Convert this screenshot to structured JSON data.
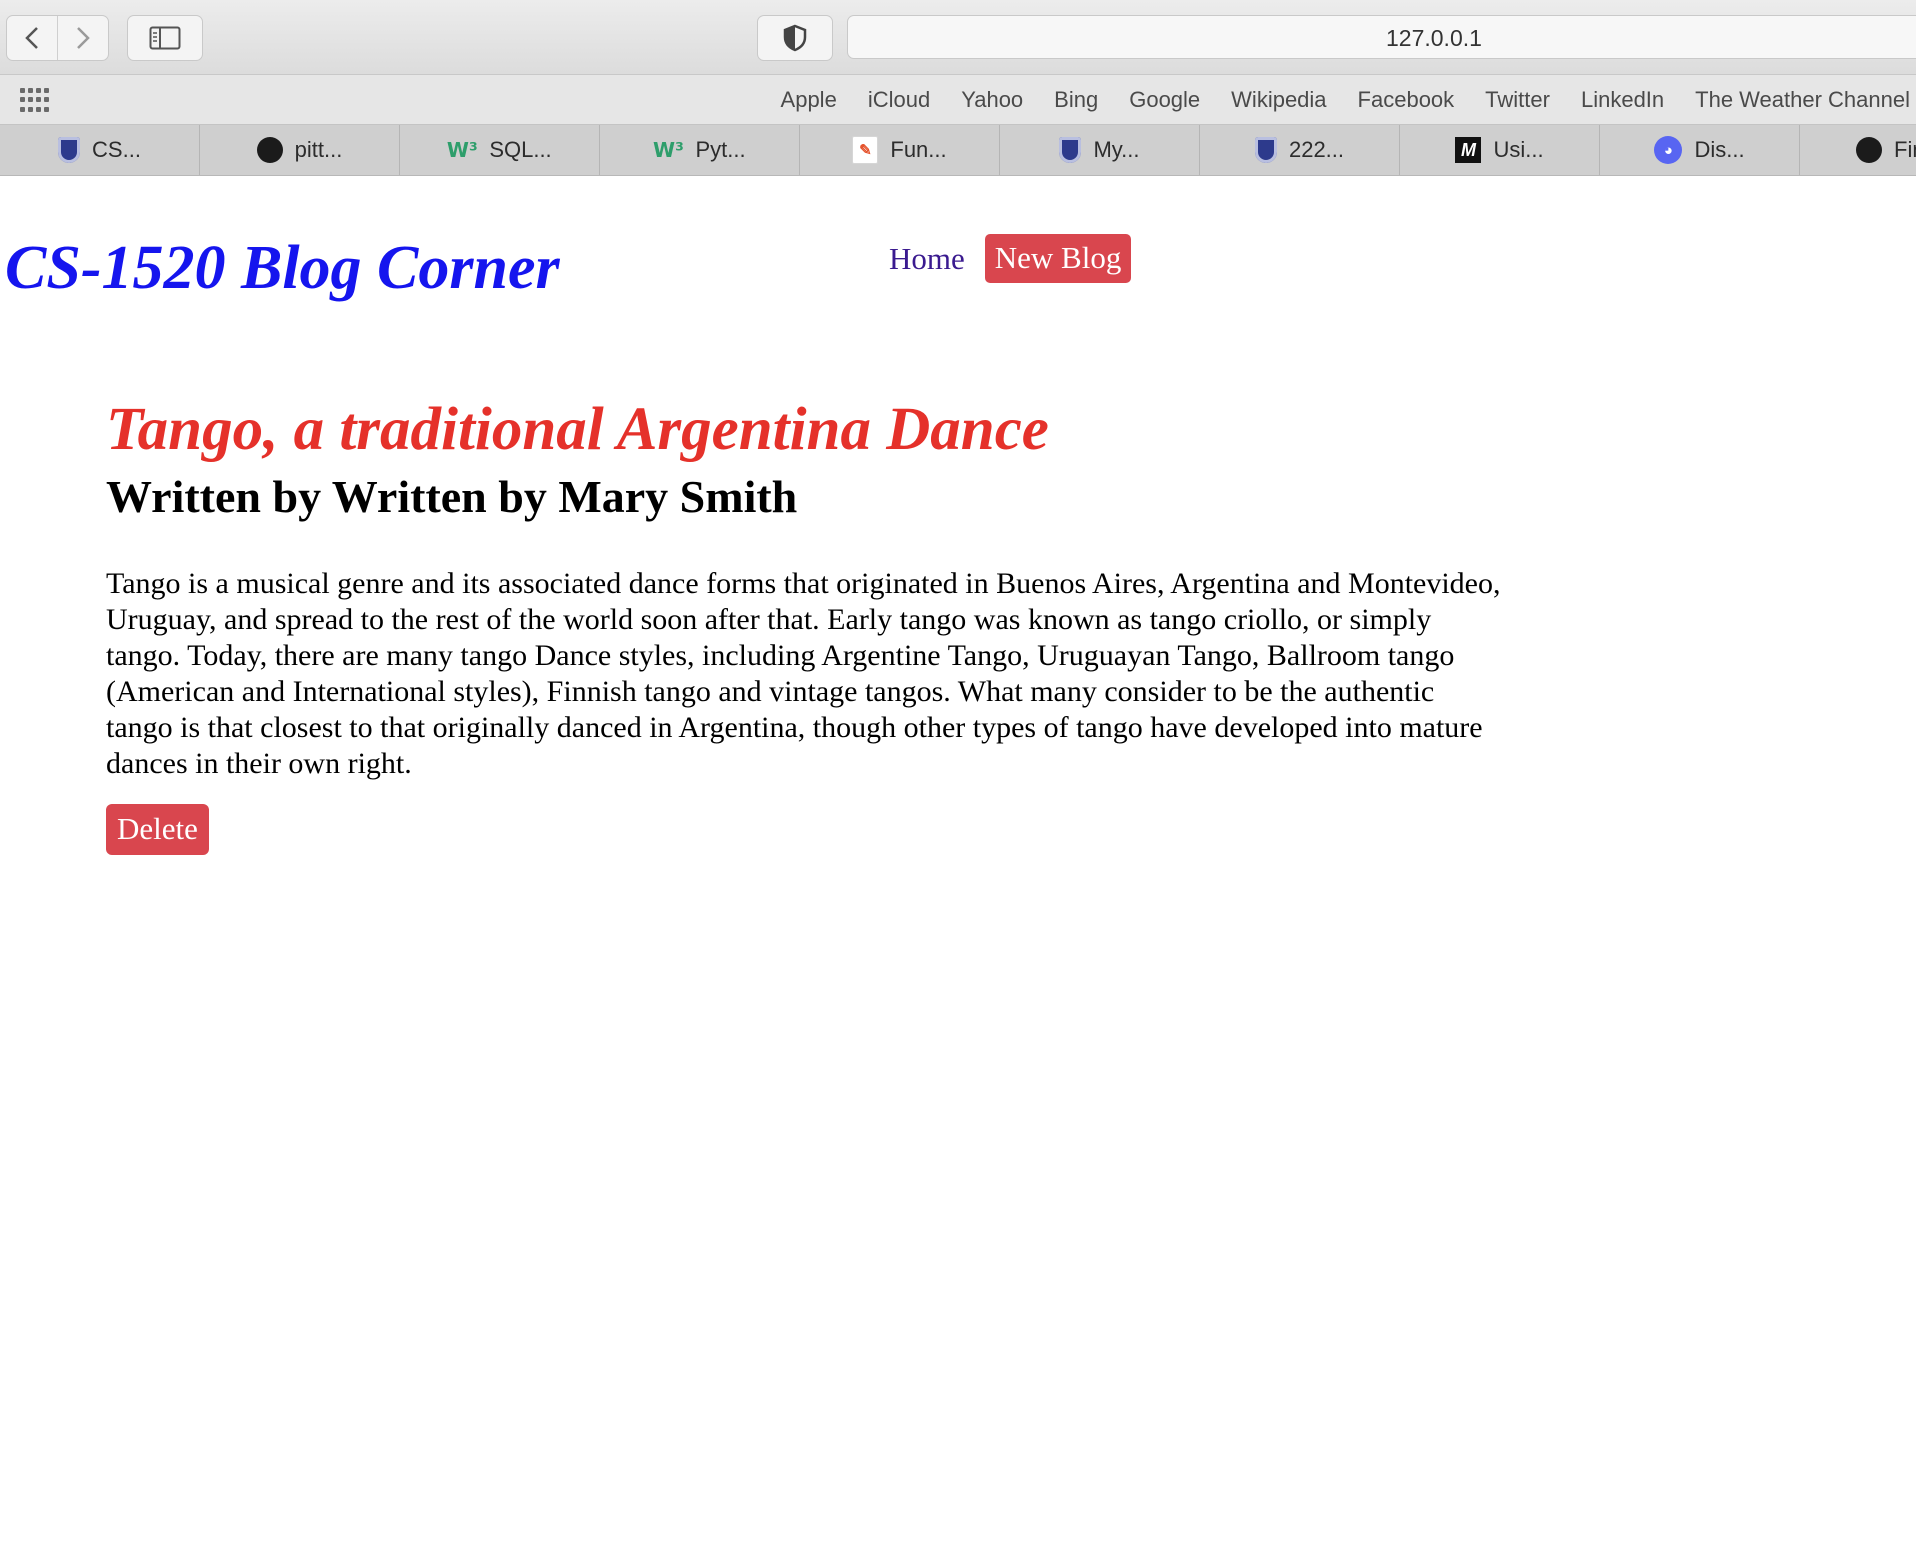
{
  "browser": {
    "url": "127.0.0.1",
    "favorites": [
      "Apple",
      "iCloud",
      "Yahoo",
      "Bing",
      "Google",
      "Wikipedia",
      "Facebook",
      "Twitter",
      "LinkedIn",
      "The Weather Channel"
    ],
    "tabs": [
      {
        "icon": "pitt-shield-icon",
        "label": "CS..."
      },
      {
        "icon": "github-icon",
        "label": "pitt..."
      },
      {
        "icon": "w3schools-icon",
        "label": "SQL..."
      },
      {
        "icon": "w3schools-icon",
        "label": "Pyt..."
      },
      {
        "icon": "book-icon",
        "label": "Fun..."
      },
      {
        "icon": "pitt-shield-icon",
        "label": "My..."
      },
      {
        "icon": "pitt-shield-icon",
        "label": "222..."
      },
      {
        "icon": "m-logo-icon",
        "label": "Usi..."
      },
      {
        "icon": "discord-icon",
        "label": "Dis..."
      },
      {
        "icon": "github-icon",
        "label": "Fin..."
      }
    ]
  },
  "site": {
    "title": "CS-1520 Blog Corner",
    "nav": {
      "home": "Home",
      "new_blog": "New Blog"
    }
  },
  "post": {
    "title": "Tango, a traditional Argentina Dance",
    "author": "Written by Written by Mary Smith",
    "body": "Tango is a musical genre and its associated dance forms that originated in Buenos Aires, Argentina and Montevideo, Uruguay, and spread to the rest of the world soon after that. Early tango was known as tango criollo, or simply tango. Today, there are many tango Dance styles, including Argentine Tango, Uruguayan Tango, Ballroom tango (American and International styles), Finnish tango and vintage tangos. What many consider to be the authentic tango is that closest to that originally danced in Argentina, though other types of tango have developed into mature dances in their own right.",
    "delete_label": "Delete"
  },
  "colors": {
    "site_title": "#1515ee",
    "post_title": "#e5312a",
    "button_bg": "#d9464e",
    "home_link": "#3a1a8f"
  }
}
